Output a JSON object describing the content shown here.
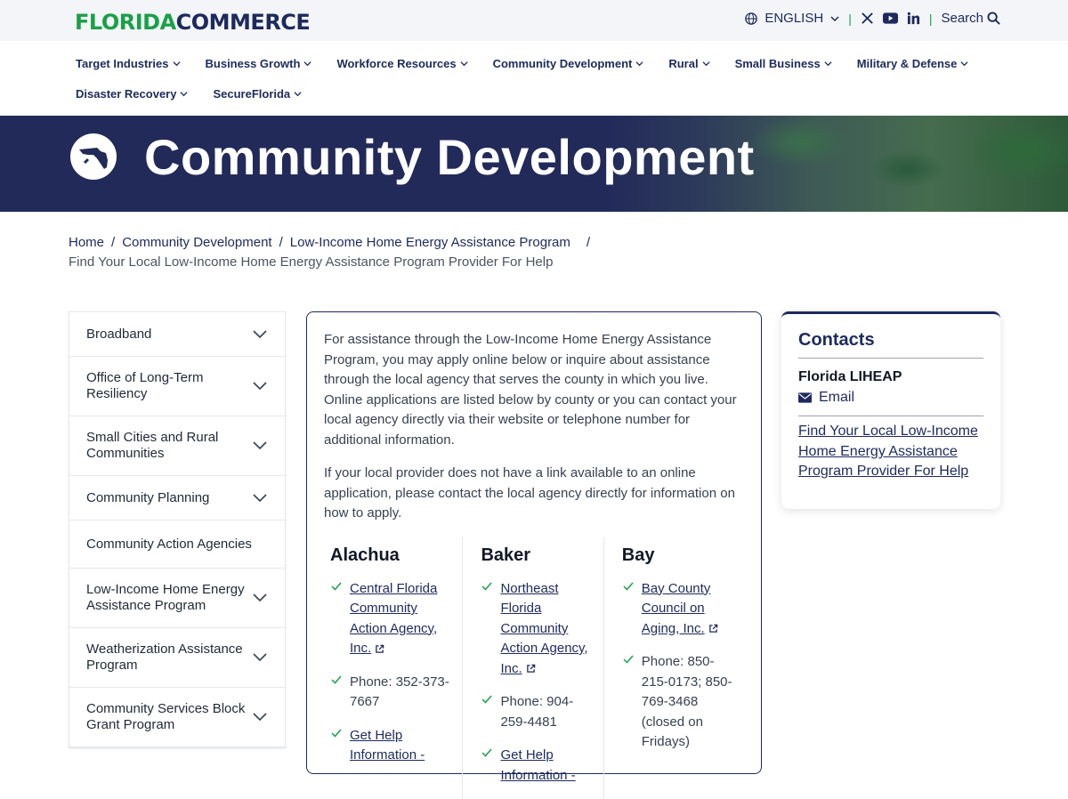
{
  "brand": {
    "logo_part1": "FLORIDA",
    "logo_part2": "COMMERCE",
    "green": "#1aa048",
    "navy": "#1d2a5e"
  },
  "utility": {
    "language": "ENGLISH",
    "search_label": "Search"
  },
  "nav": {
    "items": [
      {
        "label": "Target Industries"
      },
      {
        "label": "Business Growth"
      },
      {
        "label": "Workforce Resources"
      },
      {
        "label": "Community Development"
      },
      {
        "label": "Rural"
      },
      {
        "label": "Small Business"
      },
      {
        "label": "Military & Defense"
      },
      {
        "label": "Disaster Recovery"
      },
      {
        "label": "SecureFlorida"
      }
    ]
  },
  "hero": {
    "title": "Community Development"
  },
  "breadcrumb": {
    "home": "Home",
    "level1": "Community Development",
    "level2": "Low-Income Home Energy Assistance Program",
    "separator": "/",
    "current": "Find Your Local Low-Income Home Energy Assistance Program Provider For Help"
  },
  "sidenav": {
    "items": [
      {
        "label": "Broadband",
        "expandable": true
      },
      {
        "label": "Office of Long-Term Resiliency",
        "expandable": true
      },
      {
        "label": "Small Cities and Rural Communities",
        "expandable": true
      },
      {
        "label": "Community Planning",
        "expandable": true
      },
      {
        "label": "Community Action Agencies",
        "expandable": false
      },
      {
        "label": "Low-Income Home Energy Assistance Program",
        "expandable": true
      },
      {
        "label": "Weatherization Assistance Program",
        "expandable": true
      },
      {
        "label": "Community Services Block Grant Program",
        "expandable": true
      }
    ]
  },
  "content": {
    "para1": "For assistance through the Low-Income Home Energy Assistance Program, you may apply online below or inquire about assistance through the local agency that serves the county in which you live. Online applications are listed below by county or you can contact your local agency directly via their website or telephone number for additional information.",
    "para2": "If your local provider does not have a link available to an online application, please contact the local agency directly for information on how to apply.",
    "counties": [
      {
        "name": "Alachua",
        "agency": "Central Florida Community Action Agency, Inc.",
        "phone": "Phone: 352-373-7667",
        "help": "Get Help Information -"
      },
      {
        "name": "Baker",
        "agency": "Northeast Florida Community Action Agency, Inc.",
        "phone": "Phone: 904-259-4481",
        "help": "Get Help Information -"
      },
      {
        "name": "Bay",
        "agency": "Bay County Council on Aging, Inc.",
        "phone": "Phone: 850-215-0173; 850-769-3468 (closed on Fridays)"
      }
    ]
  },
  "contacts": {
    "title": "Contacts",
    "org": "Florida LIHEAP",
    "email_label": "Email",
    "link": "Find Your Local Low-Income Home Energy Assistance Program Provider For Help"
  }
}
